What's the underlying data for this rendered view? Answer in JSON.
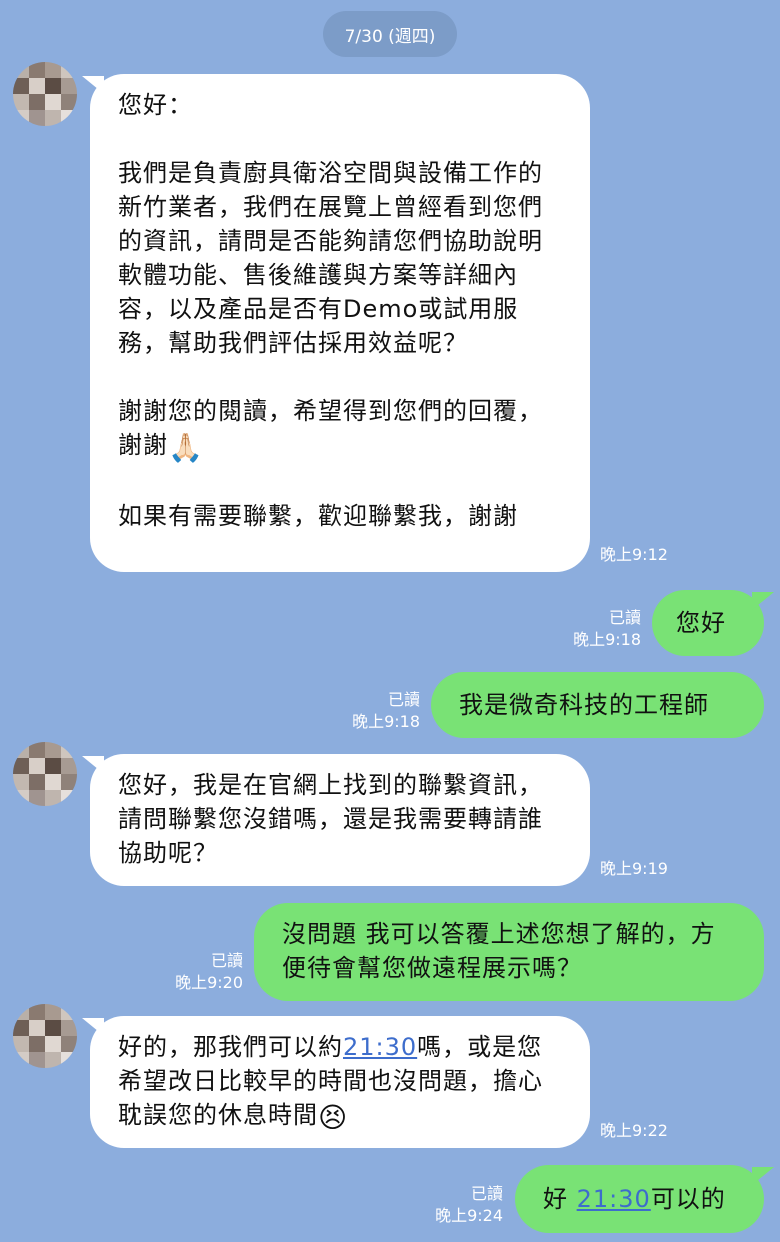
{
  "date_label": "7/30 (週四)",
  "messages": [
    {
      "text": "您好：\n\n我們是負責廚具衛浴空間與設備工作的新竹業者，我們在展覽上曾經看到您們的資訊，請問是否能夠請您們協助說明軟體功能、售後維護與方案等詳細內容，以及產品是否有Demo或試用服務，幫助我們評估採用效益呢？\n\n謝謝您的閱讀，希望得到您們的回覆，謝謝",
      "emoji": "🙏🏻",
      "tail": "\n\n如果有需要聯繫，歡迎聯繫我，謝謝",
      "time": "晚上9:12"
    },
    {
      "text": "您好",
      "read": "已讀",
      "time": "晚上9:18"
    },
    {
      "text": "我是微奇科技的工程師",
      "read": "已讀",
      "time": "晚上9:18"
    },
    {
      "text": "您好，我是在官網上找到的聯繫資訊，請問聯繫您沒錯嗎，還是我需要轉請誰協助呢？",
      "time": "晚上9:19"
    },
    {
      "text": "沒問題 我可以答覆上述您想了解的，方便待會幫您做遠程展示嗎？",
      "read": "已讀",
      "time": "晚上9:20"
    },
    {
      "text_a": "好的，那我們可以約",
      "link": "21:30",
      "text_b": "嗎，或是您希望改日比較早的時間也沒問題，擔心耽誤您的休息時間",
      "emoji": "😣",
      "time": "晚上9:22"
    },
    {
      "text_a": "好 ",
      "link": "21:30",
      "text_b": "可以的",
      "read": "已讀",
      "time": "晚上9:24"
    }
  ]
}
